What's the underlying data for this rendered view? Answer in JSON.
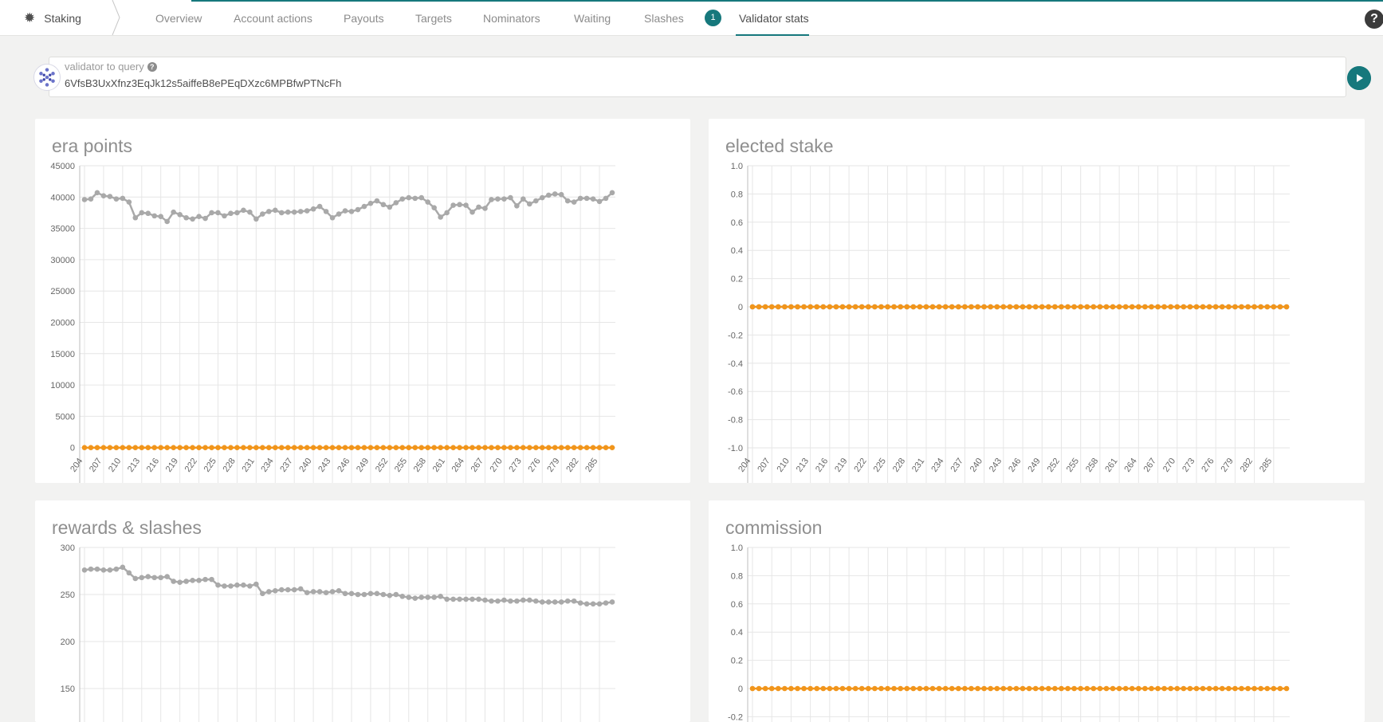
{
  "nav": {
    "brand": "Staking",
    "tabs": [
      {
        "label": "Overview"
      },
      {
        "label": "Account actions"
      },
      {
        "label": "Payouts"
      },
      {
        "label": "Targets"
      },
      {
        "label": "Nominators"
      },
      {
        "label": "Waiting"
      },
      {
        "label": "Slashes"
      },
      {
        "label": "Validator stats"
      }
    ],
    "slashes_badge": "1",
    "active_tab": "Validator stats",
    "help": "?"
  },
  "validator": {
    "label": "validator to query",
    "value": "6VfsB3UxXfnz3EqJk12s5aiffeB8ePEqDXzc6MPBfwPTNcFh"
  },
  "colors": {
    "accent": "#16787c",
    "series_gray": "#a9a9a9",
    "series_orange": "#f1951b"
  },
  "chart_data": [
    {
      "type": "line",
      "title": "era points",
      "x_start": 204,
      "x_end": 287,
      "x_tick_labels": [
        "204",
        "207",
        "210",
        "213",
        "216",
        "219",
        "222",
        "225",
        "228",
        "231",
        "234",
        "237",
        "240",
        "243",
        "246",
        "249",
        "252",
        "255",
        "258",
        "261",
        "264",
        "267",
        "270",
        "273",
        "276",
        "279",
        "282",
        "285"
      ],
      "y_tick_labels": [
        "45000",
        "40000",
        "35000",
        "30000",
        "25000",
        "20000",
        "15000",
        "10000",
        "5000",
        "0"
      ],
      "ylim": [
        0,
        45000
      ],
      "series": [
        {
          "color": "#a9a9a9",
          "values": [
            39600,
            39700,
            40700,
            40200,
            40100,
            39700,
            39800,
            39200,
            36700,
            37500,
            37400,
            37000,
            36900,
            36100,
            37600,
            37200,
            36700,
            36500,
            36900,
            36600,
            37500,
            37500,
            37000,
            37400,
            37500,
            37900,
            37600,
            36500,
            37300,
            37700,
            37900,
            37500,
            37600,
            37600,
            37700,
            37800,
            38100,
            38500,
            37700,
            36700,
            37300,
            37800,
            37700,
            38000,
            38500,
            39000,
            39400,
            38800,
            38400,
            39100,
            39700,
            39900,
            39800,
            39900,
            39200,
            38300,
            36800,
            37500,
            38700,
            38800,
            38700,
            37600,
            38400,
            38200,
            39600,
            39700,
            39700,
            39900,
            38600,
            39700,
            38900,
            39400,
            39900,
            40300,
            40500,
            40400,
            39400,
            39200,
            39800,
            39800,
            39700,
            39300,
            39800,
            40700
          ]
        },
        {
          "color": "#f1951b",
          "values": [
            0,
            0,
            0,
            0,
            0,
            0,
            0,
            0,
            0,
            0,
            0,
            0,
            0,
            0,
            0,
            0,
            0,
            0,
            0,
            0,
            0,
            0,
            0,
            0,
            0,
            0,
            0,
            0,
            0,
            0,
            0,
            0,
            0,
            0,
            0,
            0,
            0,
            0,
            0,
            0,
            0,
            0,
            0,
            0,
            0,
            0,
            0,
            0,
            0,
            0,
            0,
            0,
            0,
            0,
            0,
            0,
            0,
            0,
            0,
            0,
            0,
            0,
            0,
            0,
            0,
            0,
            0,
            0,
            0,
            0,
            0,
            0,
            0,
            0,
            0,
            0,
            0,
            0,
            0,
            0,
            0,
            0,
            0,
            0
          ]
        }
      ]
    },
    {
      "type": "line",
      "title": "elected stake",
      "x_start": 204,
      "x_end": 287,
      "x_tick_labels": [
        "204",
        "207",
        "210",
        "213",
        "216",
        "219",
        "222",
        "225",
        "228",
        "231",
        "234",
        "237",
        "240",
        "243",
        "246",
        "249",
        "252",
        "255",
        "258",
        "261",
        "264",
        "267",
        "270",
        "273",
        "276",
        "279",
        "282",
        "285"
      ],
      "y_tick_labels": [
        "1.0",
        "0.8",
        "0.6",
        "0.4",
        "0.2",
        "0",
        "-0.2",
        "-0.4",
        "-0.6",
        "-0.8",
        "-1.0"
      ],
      "ylim": [
        -1,
        1
      ],
      "series": [
        {
          "color": "#a9a9a9",
          "values": [
            0,
            0,
            0,
            0,
            0,
            0,
            0,
            0,
            0,
            0,
            0,
            0,
            0,
            0,
            0,
            0,
            0,
            0,
            0,
            0,
            0,
            0,
            0,
            0,
            0,
            0,
            0,
            0,
            0,
            0,
            0,
            0,
            0,
            0,
            0,
            0,
            0,
            0,
            0,
            0,
            0,
            0,
            0,
            0,
            0,
            0,
            0,
            0,
            0,
            0,
            0,
            0,
            0,
            0,
            0,
            0,
            0,
            0,
            0,
            0,
            0,
            0,
            0,
            0,
            0,
            0,
            0,
            0,
            0,
            0,
            0,
            0,
            0,
            0,
            0,
            0,
            0,
            0,
            0,
            0,
            0,
            0,
            0,
            0
          ]
        },
        {
          "color": "#f1951b",
          "values": [
            0,
            0,
            0,
            0,
            0,
            0,
            0,
            0,
            0,
            0,
            0,
            0,
            0,
            0,
            0,
            0,
            0,
            0,
            0,
            0,
            0,
            0,
            0,
            0,
            0,
            0,
            0,
            0,
            0,
            0,
            0,
            0,
            0,
            0,
            0,
            0,
            0,
            0,
            0,
            0,
            0,
            0,
            0,
            0,
            0,
            0,
            0,
            0,
            0,
            0,
            0,
            0,
            0,
            0,
            0,
            0,
            0,
            0,
            0,
            0,
            0,
            0,
            0,
            0,
            0,
            0,
            0,
            0,
            0,
            0,
            0,
            0,
            0,
            0,
            0,
            0,
            0,
            0,
            0,
            0,
            0,
            0,
            0,
            0
          ]
        }
      ]
    },
    {
      "type": "line",
      "title": "rewards & slashes",
      "x_start": 204,
      "x_end": 287,
      "y_tick_labels": [
        "300",
        "250",
        "200",
        "150"
      ],
      "ylim": [
        0,
        300
      ],
      "series": [
        {
          "color": "#a9a9a9",
          "values": [
            276,
            277,
            277,
            276,
            276,
            277,
            279,
            273,
            267,
            268,
            269,
            268,
            268,
            269,
            264,
            263,
            264,
            265,
            265,
            266,
            266,
            260,
            259,
            259,
            260,
            260,
            259,
            261,
            251,
            253,
            254,
            255,
            255,
            255,
            256,
            252,
            253,
            253,
            252,
            253,
            254,
            251,
            251,
            250,
            250,
            251,
            251,
            250,
            249,
            250,
            248,
            247,
            246,
            247,
            247,
            247,
            248,
            245,
            245,
            245,
            245,
            245,
            245,
            244,
            243,
            243,
            244,
            243,
            243,
            244,
            244,
            243,
            242,
            242,
            242,
            242,
            243,
            243,
            241,
            240,
            240,
            240,
            241,
            242
          ]
        }
      ]
    },
    {
      "type": "line",
      "title": "commission",
      "x_start": 204,
      "x_end": 287,
      "y_tick_labels": [
        "1.0",
        "0.8",
        "0.6",
        "0.4",
        "0.2",
        "0",
        "-0.2"
      ],
      "ylim": [
        -1,
        1
      ],
      "series": [
        {
          "color": "#f1951b",
          "values": [
            0,
            0,
            0,
            0,
            0,
            0,
            0,
            0,
            0,
            0,
            0,
            0,
            0,
            0,
            0,
            0,
            0,
            0,
            0,
            0,
            0,
            0,
            0,
            0,
            0,
            0,
            0,
            0,
            0,
            0,
            0,
            0,
            0,
            0,
            0,
            0,
            0,
            0,
            0,
            0,
            0,
            0,
            0,
            0,
            0,
            0,
            0,
            0,
            0,
            0,
            0,
            0,
            0,
            0,
            0,
            0,
            0,
            0,
            0,
            0,
            0,
            0,
            0,
            0,
            0,
            0,
            0,
            0,
            0,
            0,
            0,
            0,
            0,
            0,
            0,
            0,
            0,
            0,
            0,
            0,
            0,
            0,
            0,
            0
          ]
        }
      ]
    }
  ]
}
